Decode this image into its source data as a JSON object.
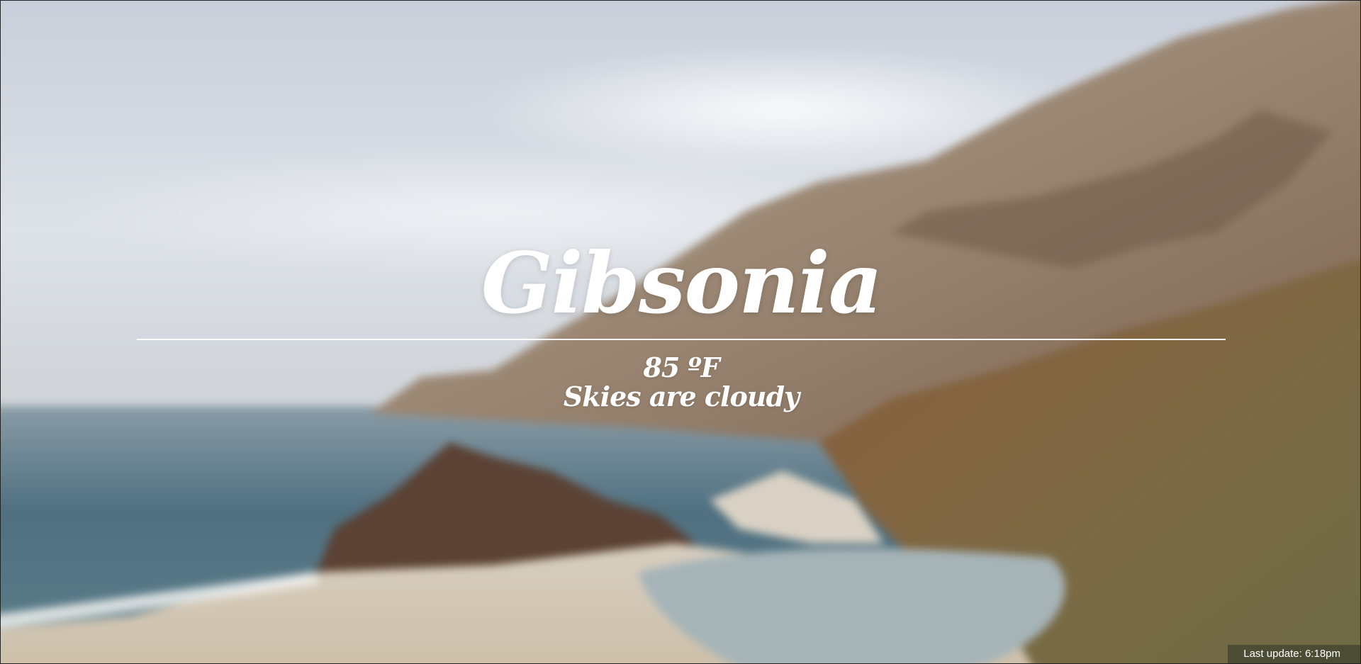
{
  "location": {
    "city": "Gibsonia"
  },
  "weather": {
    "temperature": "85 ºF",
    "condition": "Skies are cloudy"
  },
  "status": {
    "last_update": "Last update: 6:18pm"
  },
  "background": {
    "scene": "blurred coastal cliffs with beach and ocean under cloudy sky",
    "colors": {
      "sky": "#d6dbe2",
      "ocean": "#4f7080",
      "sand": "#d8cbb6",
      "cliff": "#8b6a50",
      "rock": "#5b4235"
    }
  }
}
